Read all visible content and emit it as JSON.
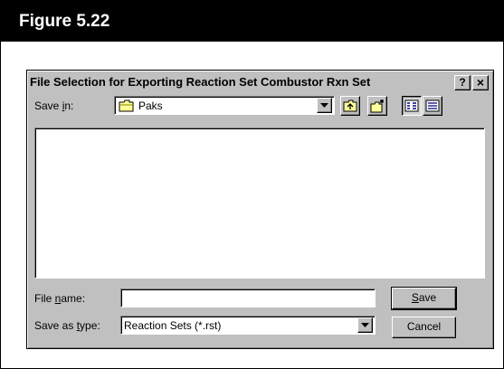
{
  "figure": {
    "title": "Figure 5.22"
  },
  "dialog": {
    "title": "File Selection for Exporting Reaction Set Combustor Rxn Set",
    "help_button": "?",
    "close_button": "×",
    "save_in": {
      "label_pre": "Save ",
      "label_mnemonic": "i",
      "label_post": "n:",
      "value": "Paks"
    },
    "file_list": [],
    "file_name": {
      "label_pre": "File ",
      "label_mnemonic": "n",
      "label_post": "ame:",
      "value": ""
    },
    "save_as_type": {
      "label_pre": "Save as ",
      "label_mnemonic": "t",
      "label_post": "ype:",
      "value": "Reaction Sets (*.rst)"
    },
    "save_button": {
      "mnemonic": "S",
      "rest": "ave"
    },
    "cancel_button": "Cancel"
  }
}
